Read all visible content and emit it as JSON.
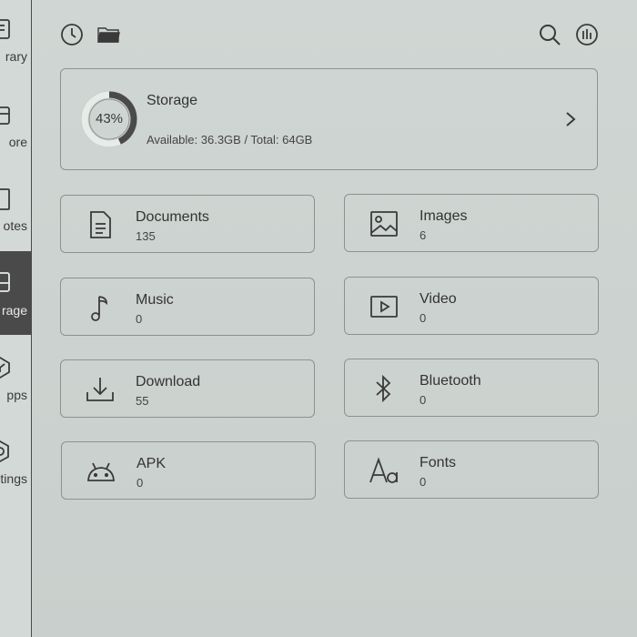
{
  "sidebar": {
    "items": [
      {
        "label": "rary",
        "icon": "library-icon"
      },
      {
        "label": "ore",
        "icon": "store-icon"
      },
      {
        "label": "otes",
        "icon": "notes-icon"
      },
      {
        "label": "rage",
        "icon": "storage-icon",
        "active": true
      },
      {
        "label": "pps",
        "icon": "apps-icon"
      },
      {
        "label": "tings",
        "icon": "settings-icon"
      }
    ]
  },
  "topbar": {
    "icons": [
      "recent-clock-icon",
      "folder-icon",
      "search-icon",
      "storage-analysis-icon"
    ]
  },
  "storage": {
    "title": "Storage",
    "percent_label": "43%",
    "used_fraction": 0.43,
    "detail": "Available: 36.3GB / Total: 64GB"
  },
  "categories": [
    {
      "title": "Documents",
      "count": "135",
      "icon": "document-icon"
    },
    {
      "title": "Images",
      "count": "6",
      "icon": "image-icon"
    },
    {
      "title": "Music",
      "count": "0",
      "icon": "music-note-icon"
    },
    {
      "title": "Video",
      "count": "0",
      "icon": "video-play-icon"
    },
    {
      "title": "Download",
      "count": "55",
      "icon": "download-icon"
    },
    {
      "title": "Bluetooth",
      "count": "0",
      "icon": "bluetooth-icon"
    },
    {
      "title": "APK",
      "count": "0",
      "icon": "android-icon"
    },
    {
      "title": "Fonts",
      "count": "0",
      "icon": "fonts-icon"
    }
  ],
  "colors": {
    "background": "#cdd3d0",
    "border": "#8d9290",
    "ring_used": "#4a4a4a",
    "ring_track": "#e8ece9",
    "active_tab": "#4a4a4a"
  }
}
